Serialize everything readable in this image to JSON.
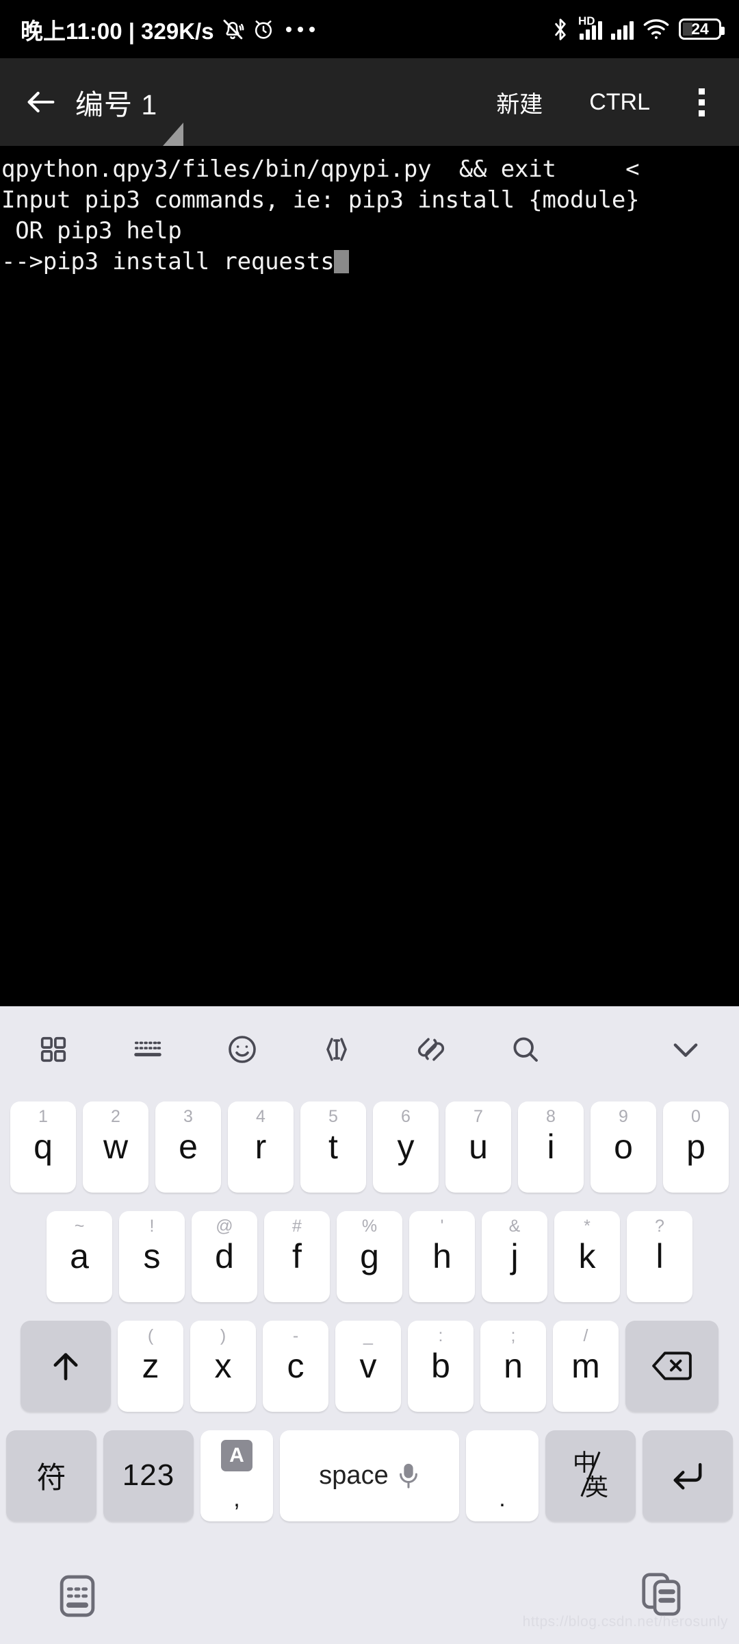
{
  "statusbar": {
    "time_and_net": "晚上11:00 | 329K/s",
    "icons": [
      "bell-muted-icon",
      "alarm-clock-icon",
      "more-dots-icon",
      "bluetooth-icon",
      "hd-signal-icon",
      "signal-icon",
      "wifi-icon",
      "battery-icon"
    ],
    "hd_label": "HD",
    "battery_percent": "24"
  },
  "appbar": {
    "back_icon": "back-arrow-icon",
    "title": "编号 1",
    "new_label": "新建",
    "ctrl_label": "CTRL",
    "menu_icon": "kebab-menu-icon"
  },
  "terminal": {
    "lines": [
      "qpython.qpy3/files/bin/qpypi.py  && exit     <",
      "Input pip3 commands, ie: pip3 install {module}",
      " OR pip3 help"
    ],
    "prompt_line": "-->pip3 install requests"
  },
  "keyboard": {
    "toolbar": [
      {
        "name": "apps-grid-icon"
      },
      {
        "name": "keyboard-icon"
      },
      {
        "name": "emoji-icon"
      },
      {
        "name": "text-cursor-icon"
      },
      {
        "name": "clip-icon"
      },
      {
        "name": "search-icon"
      },
      {
        "name": "collapse-chevron-icon"
      }
    ],
    "row1": [
      {
        "main": "q",
        "sup": "1"
      },
      {
        "main": "w",
        "sup": "2"
      },
      {
        "main": "e",
        "sup": "3"
      },
      {
        "main": "r",
        "sup": "4"
      },
      {
        "main": "t",
        "sup": "5"
      },
      {
        "main": "y",
        "sup": "6"
      },
      {
        "main": "u",
        "sup": "7"
      },
      {
        "main": "i",
        "sup": "8"
      },
      {
        "main": "o",
        "sup": "9"
      },
      {
        "main": "p",
        "sup": "0"
      }
    ],
    "row2": [
      {
        "main": "a",
        "sup": "~"
      },
      {
        "main": "s",
        "sup": "!"
      },
      {
        "main": "d",
        "sup": "@"
      },
      {
        "main": "f",
        "sup": "#"
      },
      {
        "main": "g",
        "sup": "%"
      },
      {
        "main": "h",
        "sup": "'"
      },
      {
        "main": "j",
        "sup": "&"
      },
      {
        "main": "k",
        "sup": "*"
      },
      {
        "main": "l",
        "sup": "?"
      }
    ],
    "row3": [
      {
        "main": "z",
        "sup": "("
      },
      {
        "main": "x",
        "sup": ")"
      },
      {
        "main": "c",
        "sup": "-"
      },
      {
        "main": "v",
        "sup": "_"
      },
      {
        "main": "b",
        "sup": ":"
      },
      {
        "main": "n",
        "sup": ";"
      },
      {
        "main": "m",
        "sup": "/"
      }
    ],
    "shift_icon": "shift-arrow-icon",
    "backspace_icon": "backspace-icon",
    "symbols_label": "符",
    "numbers_label": "123",
    "comma_badge": "A",
    "comma_label": ",",
    "space_label": "space",
    "mic_icon": "microphone-icon",
    "period_label": ".",
    "lang_cn": "中",
    "lang_en": "英",
    "enter_icon": "enter-icon"
  },
  "navbar": {
    "hide_keyboard_icon": "hide-keyboard-icon",
    "recents_icon": "recent-apps-icon",
    "watermark": "https://blog.csdn.net/herosunly"
  }
}
